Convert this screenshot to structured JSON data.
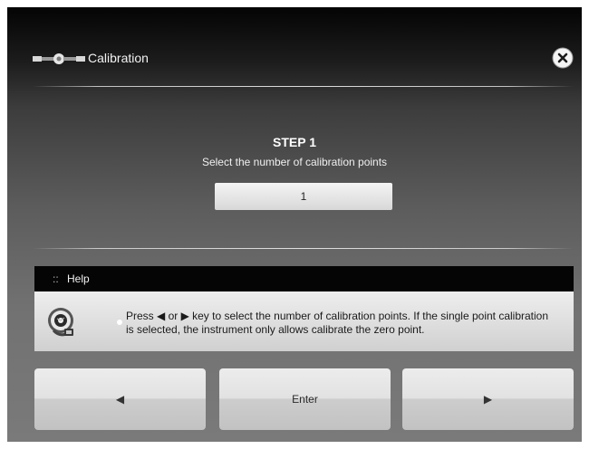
{
  "header": {
    "title": "Calibration",
    "logo_icon": "calibration-wrench-icon",
    "close_icon": "close-icon"
  },
  "step": {
    "title": "STEP 1",
    "subtitle": "Select the number of calibration points",
    "value": "1"
  },
  "help": {
    "dots": "::",
    "title": "Help",
    "icon": "help-disc-icon",
    "text": "Press ◀ or ▶ key to select the number of calibration points. If the single point calibration is selected, the instrument only allows calibrate the zero point."
  },
  "buttons": {
    "prev_icon": "left-arrow-icon",
    "prev_glyph": "◀",
    "enter_label": "Enter",
    "next_icon": "right-arrow-icon",
    "next_glyph": "▶"
  }
}
